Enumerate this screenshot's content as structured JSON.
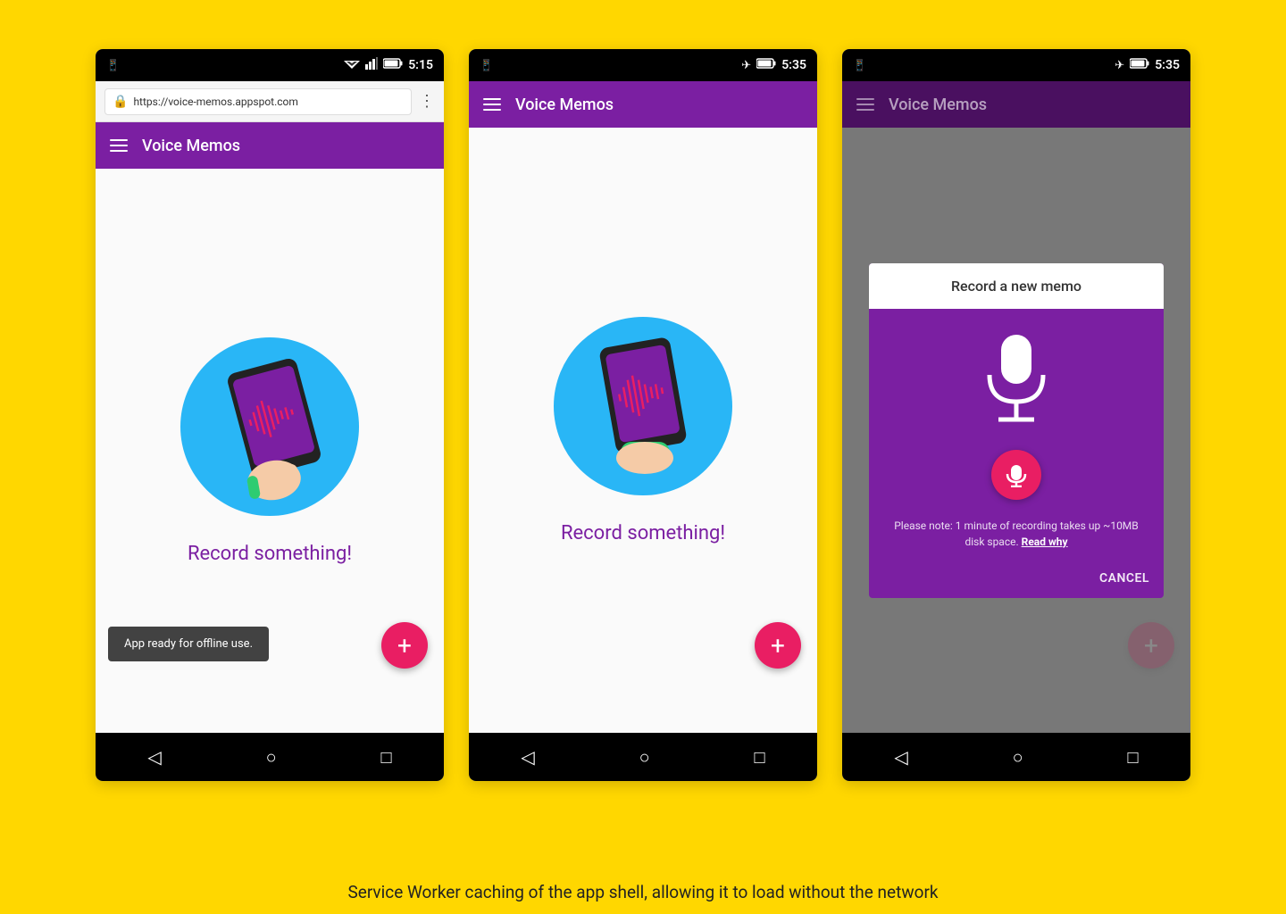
{
  "background": "#FFD700",
  "caption": "Service Worker caching of the app shell, allowing it to load without the network",
  "phone1": {
    "statusBar": {
      "time": "5:15"
    },
    "chromeBar": {
      "url": "https://voice-memos.appspot.com"
    },
    "toolbar": {
      "title": "Voice Memos"
    },
    "body": {
      "recordLabel": "Record something!"
    },
    "snackbar": {
      "text": "App ready for offline use."
    },
    "fab": {
      "label": "+"
    },
    "nav": {
      "back": "◁",
      "home": "○",
      "recent": "□"
    }
  },
  "phone2": {
    "statusBar": {
      "time": "5:35"
    },
    "toolbar": {
      "title": "Voice Memos"
    },
    "body": {
      "recordLabel": "Record something!"
    },
    "fab": {
      "label": "+"
    },
    "nav": {
      "back": "◁",
      "home": "○",
      "recent": "□"
    }
  },
  "phone3": {
    "statusBar": {
      "time": "5:35"
    },
    "toolbar": {
      "title": "Voice Memos"
    },
    "dialog": {
      "title": "Record a new memo",
      "note": "Please note: 1 minute of recording takes up ~10MB disk space.",
      "readWhy": "Read why",
      "cancel": "CANCEL"
    },
    "fab": {
      "label": "+"
    },
    "nav": {
      "back": "◁",
      "home": "○",
      "recent": "□"
    }
  }
}
